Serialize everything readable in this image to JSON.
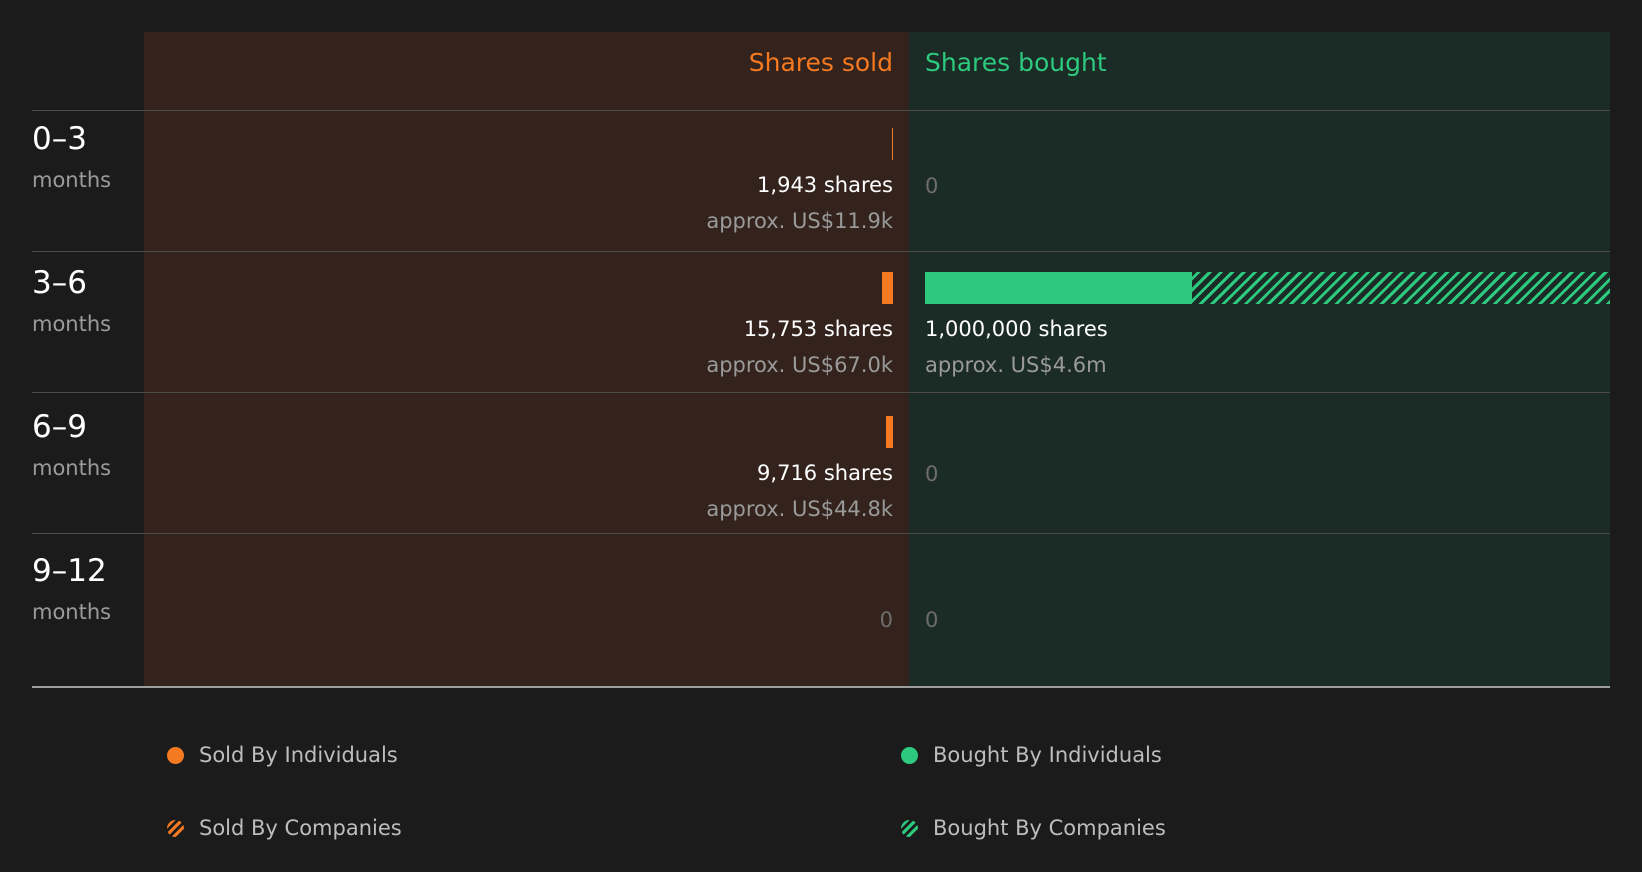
{
  "chart_data": {
    "type": "bar",
    "title": "",
    "headers": {
      "sold": "Shares sold",
      "bought": "Shares bought"
    },
    "categories": [
      "0–3",
      "3–6",
      "6–9",
      "9–12"
    ],
    "period_unit": "months",
    "rows": [
      {
        "period": "0–3",
        "unit": "months",
        "sold_shares": 1943,
        "sold_label": "1,943 shares",
        "sold_value": "approx. US$11.9k",
        "bought_shares": 0,
        "bought_label": "0",
        "bought_value": "",
        "bought_individuals": 0,
        "bought_companies": 0
      },
      {
        "period": "3–6",
        "unit": "months",
        "sold_shares": 15753,
        "sold_label": "15,753 shares",
        "sold_value": "approx. US$67.0k",
        "bought_shares": 1000000,
        "bought_label": "1,000,000 shares",
        "bought_value": "approx. US$4.6m",
        "bought_individuals": 390000,
        "bought_companies": 610000
      },
      {
        "period": "6–9",
        "unit": "months",
        "sold_shares": 9716,
        "sold_label": "9,716 shares",
        "sold_value": "approx. US$44.8k",
        "bought_shares": 0,
        "bought_label": "0",
        "bought_value": "",
        "bought_individuals": 0,
        "bought_companies": 0
      },
      {
        "period": "9–12",
        "unit": "months",
        "sold_shares": 0,
        "sold_label": "0",
        "sold_value": "",
        "bought_shares": 0,
        "bought_label": "0",
        "bought_value": "",
        "bought_individuals": 0,
        "bought_companies": 0
      }
    ],
    "series": [
      {
        "name": "Sold By Individuals",
        "color": "#f47920",
        "pattern": "solid"
      },
      {
        "name": "Sold By Companies",
        "color": "#f47920",
        "pattern": "hatched"
      },
      {
        "name": "Bought By Individuals",
        "color": "#2dc97e",
        "pattern": "solid"
      },
      {
        "name": "Bought By Companies",
        "color": "#2dc97e",
        "pattern": "hatched"
      }
    ],
    "legend_position": "bottom",
    "grid": false
  },
  "legend": {
    "sold_individuals": "Sold By Individuals",
    "sold_companies": "Sold By Companies",
    "bought_individuals": "Bought By Individuals",
    "bought_companies": "Bought By Companies"
  },
  "colors": {
    "sold": "#f47920",
    "bought": "#2dc97e",
    "sold_panel_bg": "#33231c",
    "bought_panel_bg": "#1b2b25",
    "page_bg": "#1b1b1b"
  }
}
